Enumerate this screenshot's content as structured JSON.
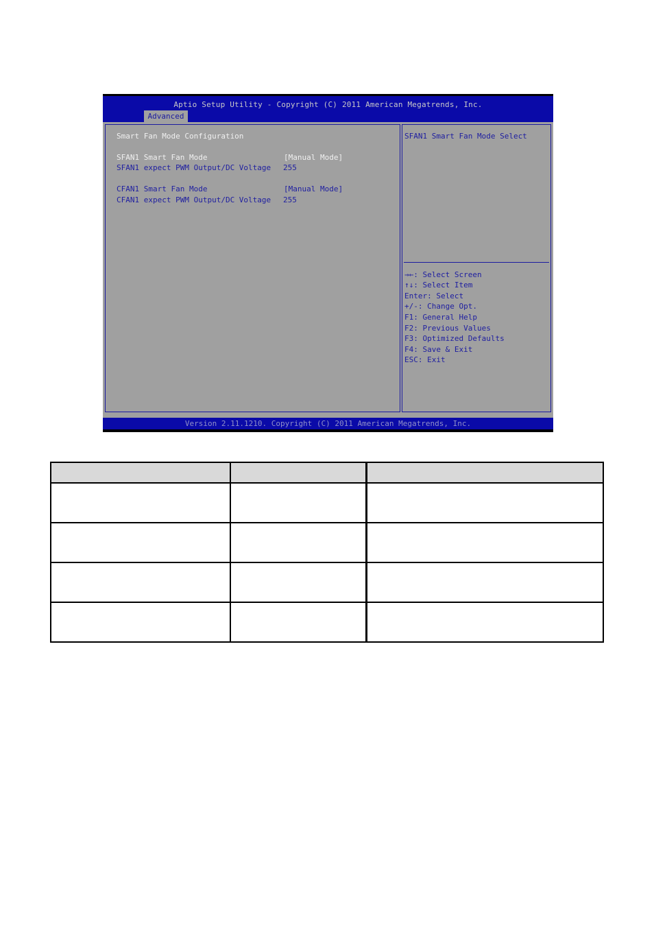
{
  "bios": {
    "title": "Aptio Setup Utility - Copyright (C) 2011 American Megatrends, Inc.",
    "active_tab": "Advanced",
    "section_title": "Smart Fan Mode Configuration",
    "settings": [
      {
        "label": "SFAN1 Smart Fan Mode",
        "value": "[Manual Mode]",
        "selected": true
      },
      {
        "label": "SFAN1 expect PWM Output/DC Voltage",
        "value": "255",
        "selected": false
      },
      {
        "label": "CFAN1 Smart Fan Mode",
        "value": "[Manual Mode]",
        "selected": false
      },
      {
        "label": "CFAN1 expect PWM Output/DC Voltage",
        "value": "255",
        "selected": false
      }
    ],
    "help_text": "SFAN1 Smart Fan Mode Select",
    "key_help": [
      "→←: Select Screen",
      "↑↓: Select Item",
      "Enter: Select",
      "+/-: Change Opt.",
      "F1: General Help",
      "F2: Previous Values",
      "F3: Optimized Defaults",
      "F4: Save & Exit",
      "ESC: Exit"
    ],
    "footer": "Version 2.11.1210. Copyright (C) 2011 American Megatrends, Inc.",
    "colors": {
      "header_blue": "#0a0aa8",
      "panel_gray": "#a0a0a0",
      "text_blue": "#1e1ea0",
      "text_white": "#f0f0f0"
    }
  },
  "table": {
    "headers": [
      "",
      "",
      ""
    ],
    "rows": [
      [
        "",
        "",
        ""
      ],
      [
        "",
        "",
        ""
      ],
      [
        "",
        "",
        ""
      ],
      [
        "",
        "",
        ""
      ]
    ]
  }
}
